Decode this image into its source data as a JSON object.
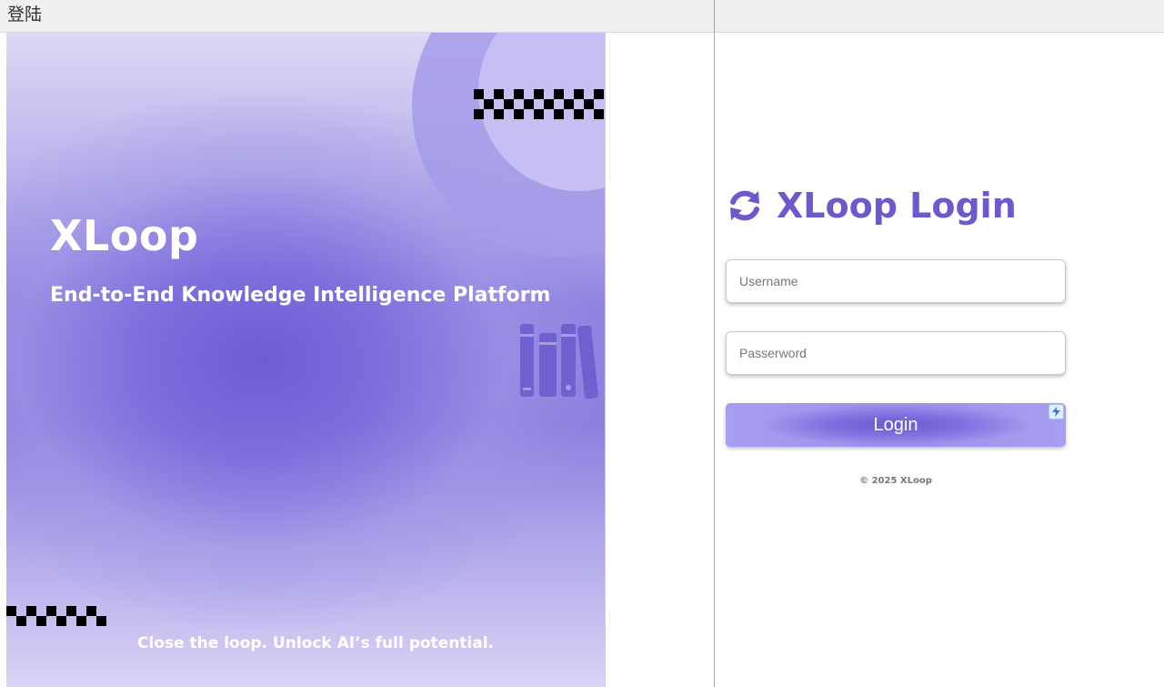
{
  "window": {
    "title": "登陆"
  },
  "hero": {
    "title": "XLoop",
    "subtitle": "End-to-End Knowledge Intelligence Platform",
    "tagline": "Close the loop. Unlock AI’s full potential.",
    "icons": [
      "books-icon"
    ]
  },
  "login": {
    "title": "XLoop Login",
    "title_icon": "refresh-icon",
    "username_placeholder": "Username",
    "password_placeholder": "Passerword",
    "button_label": "Login",
    "badge_icon": "bolt-icon",
    "copyright": "© 2025 XLoop"
  },
  "colors": {
    "accent": "#6a5acd",
    "hero_center": "#6c5ed3",
    "hero_light": "#dcd8f4"
  }
}
